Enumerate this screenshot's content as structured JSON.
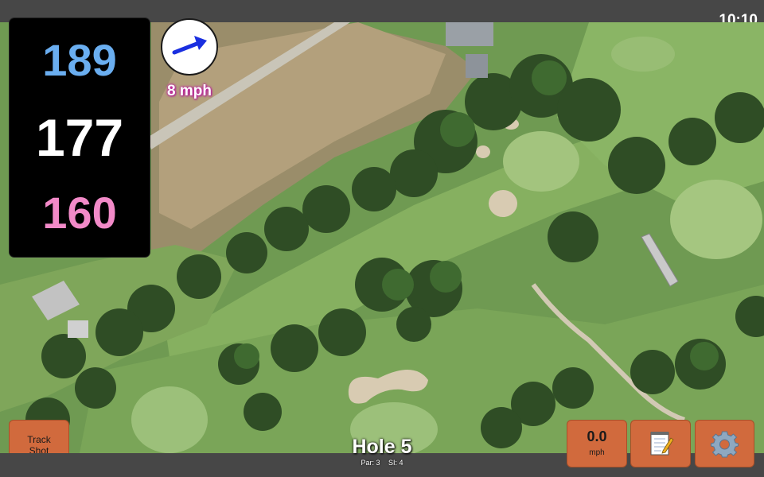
{
  "status_bar": {
    "time": "10:10"
  },
  "distances": {
    "back": "189",
    "middle": "177",
    "front": "160"
  },
  "wind": {
    "speed_label": "8 mph",
    "direction_icon": "arrow-northeast-icon"
  },
  "hole": {
    "title": "Hole 5",
    "par_label": "Par: 3",
    "si_label": "SI: 4"
  },
  "buttons": {
    "track_shot_line1": "Track",
    "track_shot_line2": "Shot",
    "speed_value": "0.0",
    "speed_unit": "mph",
    "notes_icon": "notepad-icon",
    "settings_icon": "gear-icon"
  },
  "colors": {
    "back": "#6aaef0",
    "middle": "#ffffff",
    "front": "#f28ac8",
    "button": "#d16a3d",
    "wind_arrow": "#1a2fe0"
  }
}
